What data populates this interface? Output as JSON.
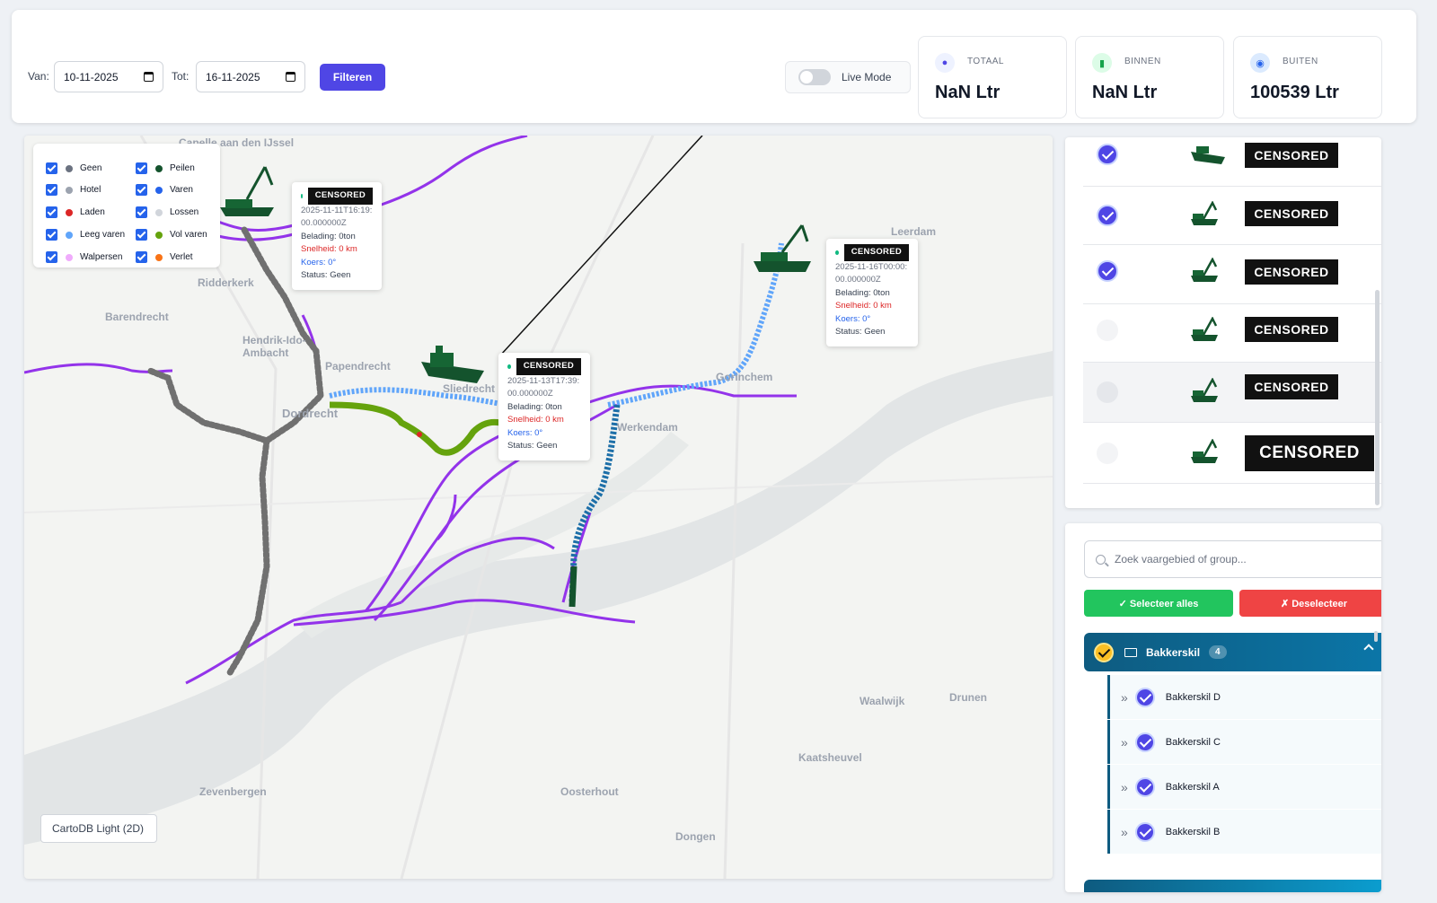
{
  "filters": {
    "from_label": "Van:",
    "from_value": "10-11-2025",
    "to_label": "Tot:",
    "to_value": "16-11-2025",
    "filter_button": "Filteren",
    "live_mode_label": "Live Mode",
    "live_mode_on": false
  },
  "stats": [
    {
      "label": "TOTAAL",
      "value": "NaN Ltr",
      "icon": "droplet-icon",
      "color": "#4f46e5"
    },
    {
      "label": "BINNEN",
      "value": "NaN Ltr",
      "icon": "map-icon",
      "color": "#16a34a"
    },
    {
      "label": "BUITEN",
      "value": "100539 Ltr",
      "icon": "compass-icon",
      "color": "#2563eb"
    }
  ],
  "map": {
    "places": [
      "Capelle aan den IJssel",
      "Ridderkerk",
      "Barendrecht",
      "Hendrik-Ido-Ambacht",
      "Papendrecht",
      "Sliedrecht",
      "Dordrecht",
      "Werkendam",
      "Gorinchem",
      "Leerdam",
      "Waalwijk",
      "Drunen",
      "Kaatsheuvel",
      "Zevenbergen",
      "Oosterhout",
      "Dongen"
    ],
    "basemap_label": "CartoDB Light (2D)",
    "legend": [
      {
        "label": "Geen",
        "color": "#6b7280"
      },
      {
        "label": "Peilen",
        "color": "#14532d"
      },
      {
        "label": "Hotel",
        "color": "#9ca3af"
      },
      {
        "label": "Varen",
        "color": "#2563eb"
      },
      {
        "label": "Laden",
        "color": "#dc2626"
      },
      {
        "label": "Lossen",
        "color": "#d1d5db"
      },
      {
        "label": "Leeg varen",
        "color": "#60a5fa"
      },
      {
        "label": "Vol varen",
        "color": "#65a30d"
      },
      {
        "label": "Walpersen",
        "color": "#f0abfc"
      },
      {
        "label": "Verlet",
        "color": "#f97316"
      }
    ],
    "popups": [
      {
        "name": "CENSORED",
        "ts": "2025-11-11T16:19:00.000000Z",
        "belading": "Belading: 0ton",
        "snelheid": "Snelheid: 0 km",
        "koers": "Koers: 0°",
        "status": "Status: Geen"
      },
      {
        "name": "CENSORED",
        "ts": "2025-11-13T17:39:00.000000Z",
        "belading": "Belading: 0ton",
        "snelheid": "Snelheid: 0 km",
        "koers": "Koers: 0°",
        "status": "Status: Geen"
      },
      {
        "name": "CENSORED",
        "ts": "2025-11-16T00:00:00.000000Z",
        "belading": "Belading: 0ton",
        "snelheid": "Snelheid: 0 km",
        "koers": "Koers: 0°",
        "status": "Status: Geen"
      }
    ]
  },
  "vessels": [
    {
      "name": "CENSORED",
      "selected": true,
      "ship_icon": "tug-boat-icon"
    },
    {
      "name": "CENSORED",
      "selected": true,
      "ship_icon": "crane-ship-icon"
    },
    {
      "name": "CENSORED",
      "selected": true,
      "ship_icon": "crane-ship-icon"
    },
    {
      "name": "CENSORED",
      "selected": false,
      "ship_icon": "crane-ship-icon"
    },
    {
      "name": "CENSORED",
      "selected": false,
      "ship_icon": "crane-ship-icon"
    },
    {
      "name": "CENSORED",
      "selected": false,
      "ship_icon": "crane-ship-icon"
    }
  ],
  "groups": {
    "search_placeholder": "Zoek vaargebied of group...",
    "select_all": "✓ Selecteer alles",
    "deselect": "✗ Deselecteer",
    "group_name": "Bakkerskil",
    "group_count": "4",
    "areas": [
      "Bakkerskil D",
      "Bakkerskil C",
      "Bakkerskil A",
      "Bakkerskil B"
    ]
  }
}
